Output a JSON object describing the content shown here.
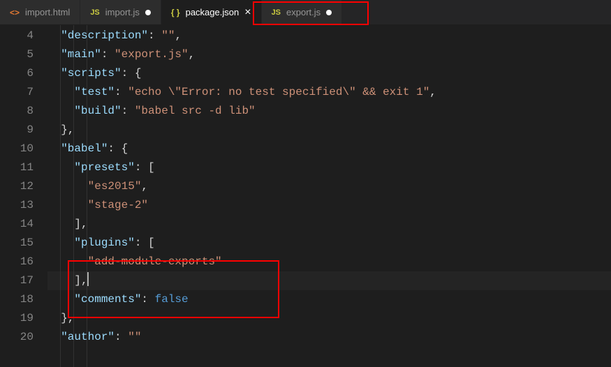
{
  "tabs": [
    {
      "label": "import.html",
      "iconType": "html",
      "state": "inactive",
      "indicator": "none"
    },
    {
      "label": "import.js",
      "iconType": "js",
      "state": "inactive-dirty",
      "indicator": "dot"
    },
    {
      "label": "package.json",
      "iconType": "json",
      "state": "active",
      "indicator": "close"
    },
    {
      "label": "export.js",
      "iconType": "js",
      "state": "inactive-dirty",
      "indicator": "dot"
    }
  ],
  "lineStart": 4,
  "lineNumbers": [
    "4",
    "5",
    "6",
    "7",
    "8",
    "9",
    "10",
    "11",
    "12",
    "13",
    "14",
    "15",
    "16",
    "17",
    "18",
    "19",
    "20"
  ],
  "code": {
    "l4": {
      "indent": "  ",
      "key": "\"description\"",
      "colon": ": ",
      "val": "\"\"",
      "tail": ","
    },
    "l5": {
      "indent": "  ",
      "key": "\"main\"",
      "colon": ": ",
      "val": "\"export.js\"",
      "tail": ","
    },
    "l6": {
      "indent": "  ",
      "key": "\"scripts\"",
      "colon": ": ",
      "open": "{"
    },
    "l7": {
      "indent": "    ",
      "key": "\"test\"",
      "colon": ": ",
      "val": "\"echo \\\"Error: no test specified\\\" && exit 1\"",
      "tail": ","
    },
    "l8": {
      "indent": "    ",
      "key": "\"build\"",
      "colon": ": ",
      "val": "\"babel src -d lib\""
    },
    "l9": {
      "indent": "  ",
      "close": "},",
      "tail": ""
    },
    "l10": {
      "indent": "  ",
      "key": "\"babel\"",
      "colon": ": ",
      "open": "{"
    },
    "l11": {
      "indent": "    ",
      "key": "\"presets\"",
      "colon": ": ",
      "open": "["
    },
    "l12": {
      "indent": "      ",
      "val": "\"es2015\"",
      "tail": ","
    },
    "l13": {
      "indent": "      ",
      "val": "\"stage-2\""
    },
    "l14": {
      "indent": "    ",
      "close": "],",
      "tail": ""
    },
    "l15": {
      "indent": "    ",
      "key": "\"plugins\"",
      "colon": ": ",
      "open": "["
    },
    "l16": {
      "indent": "      ",
      "val": "\"add-module-exports\""
    },
    "l17": {
      "indent": "    ",
      "close": "],",
      "tail": ""
    },
    "l18": {
      "indent": "    ",
      "key": "\"comments\"",
      "colon": ": ",
      "const": "false"
    },
    "l19": {
      "indent": "  ",
      "close": "},",
      "tail": ""
    },
    "l20": {
      "indent": "  ",
      "key": "\"author\"",
      "colon": ": ",
      "val": "\"\""
    }
  },
  "highlights": {
    "tabBox": "package.json",
    "codeBox": "plugins-block"
  }
}
